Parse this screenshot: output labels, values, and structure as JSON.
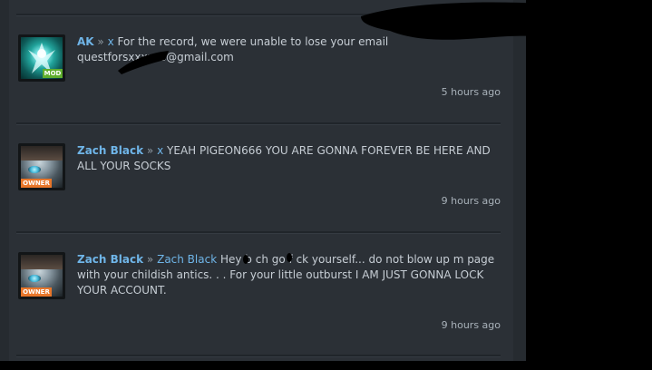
{
  "comments": [
    {
      "author": "AK",
      "separator": "»",
      "reply_to": "x",
      "text": "For the record, we were unable to lose your email questforsxxxxxs@gmail.com",
      "rank": "MOD",
      "avatar": "glowing-figure-avatar",
      "time": "5 hours ago"
    },
    {
      "author": "Zach Black",
      "separator": "»",
      "reply_to": "x",
      "text": "YEAH PIGEON666 YOU ARE GONNA FOREVER BE HERE AND ALL YOUR SOCKS",
      "rank": "OWNER",
      "avatar": "face-closeup-avatar",
      "time": "9 hours ago"
    },
    {
      "author": "Zach Black",
      "separator": "»",
      "reply_to": "Zach Black",
      "text": "Hey b  ch go f  ck yourself... do not blow up m page with your childish antics. . . For your little outburst I AM JUST GONNA LOCK YOUR ACCOUNT.",
      "rank": "OWNER",
      "avatar": "face-closeup-avatar",
      "time": "9 hours ago"
    }
  ],
  "colors": {
    "panel": "#2b3036",
    "author": "#6fb5e8",
    "text": "#c6cdd4",
    "badge_mod": "#5fae2e",
    "badge_owner": "#e8762a"
  }
}
